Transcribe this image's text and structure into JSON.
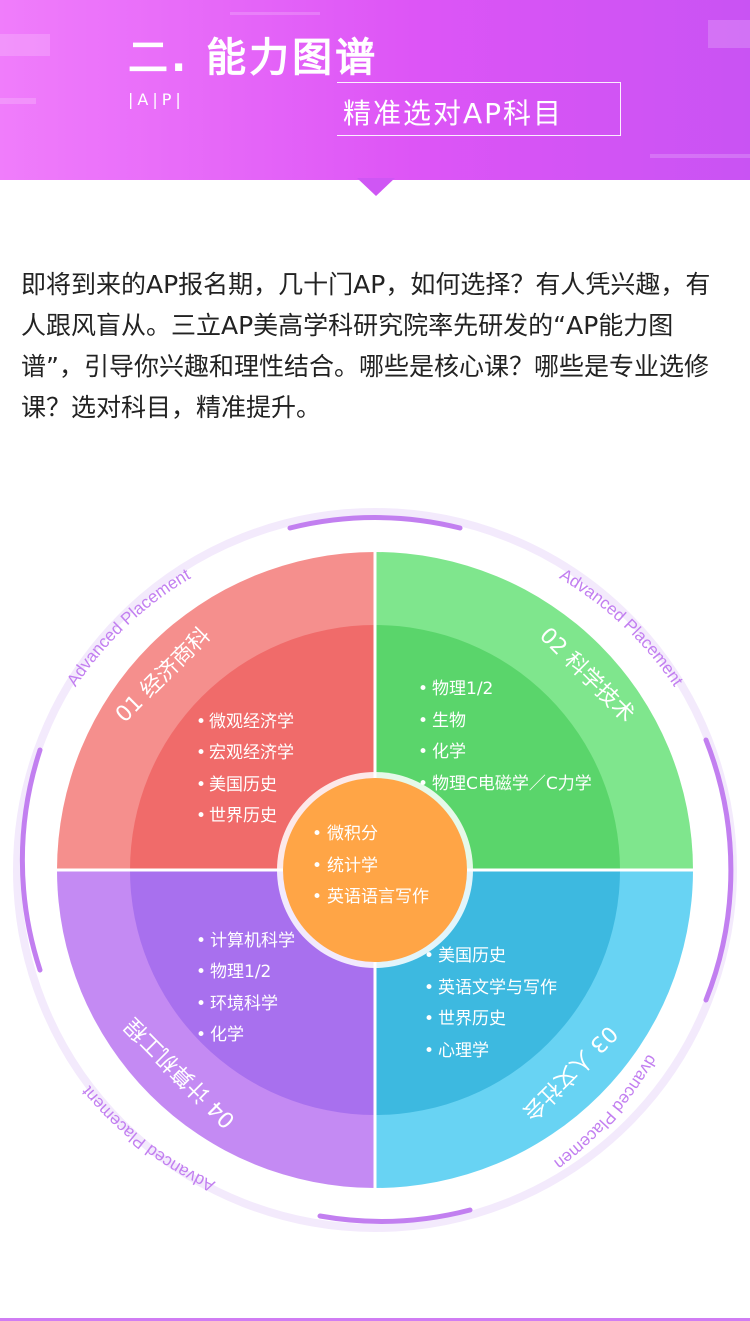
{
  "header": {
    "title": "二. 能力图谱",
    "ap_mark": "|A|P|",
    "subtitle": "精准选对AP科目"
  },
  "intro": {
    "text": "即将到来的AP报名期，几十门AP，如何选择？有人凭兴趣，有人跟风盲从。三立AP美高学科研究院率先研发的“AP能力图谱”，引导你兴趣和理性结合。哪些是核心课？哪些是专业选修课？选对科目，精准提升。"
  },
  "wheel": {
    "ring_label": "Advanced Placement",
    "center": {
      "items": [
        "微积分",
        "统计学",
        "英语语言写作"
      ]
    },
    "quadrants": [
      {
        "title": "01 经济商科",
        "items": [
          "微观经济学",
          "宏观经济学",
          "美国历史",
          "世界历史"
        ]
      },
      {
        "title": "02 科学技术",
        "items": [
          "物理1/2",
          "生物",
          "化学",
          "物理C电磁学／C力学"
        ]
      },
      {
        "title": "03 人文社会",
        "items": [
          "美国历史",
          "英语文学与写作",
          "世界历史",
          "心理学"
        ]
      },
      {
        "title": "04 计算机工程",
        "items": [
          "计算机科学",
          "物理1/2",
          "环境科学",
          "化学"
        ]
      }
    ],
    "colors": {
      "q1_outer": "#f58f8d",
      "q1_inner": "#f06b6a",
      "q2_outer": "#7fe68d",
      "q2_inner": "#5ad56b",
      "q3_outer": "#68d3f3",
      "q3_inner": "#3db9e0",
      "q4_outer": "#c48af3",
      "q4_inner": "#a870ee",
      "center": "#ffa546",
      "ring": "#c27ff0"
    }
  }
}
